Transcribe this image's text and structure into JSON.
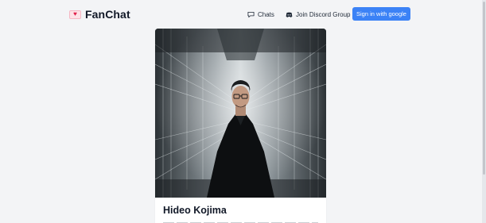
{
  "brand": {
    "name": "FanChat",
    "icon": "heart-icon"
  },
  "nav": {
    "chats_label": "Chats",
    "chats_icon": "chat-bubble-icon",
    "discord_label": "Join Discord Group",
    "discord_icon": "discord-icon",
    "signin_label": "Sign in with google"
  },
  "colors": {
    "accent": "#3b82f6",
    "background": "#f3f4f6",
    "card": "#ffffff"
  },
  "character": {
    "name": "Hideo Kojima",
    "image_alt": "Hideo Kojima portrait"
  }
}
